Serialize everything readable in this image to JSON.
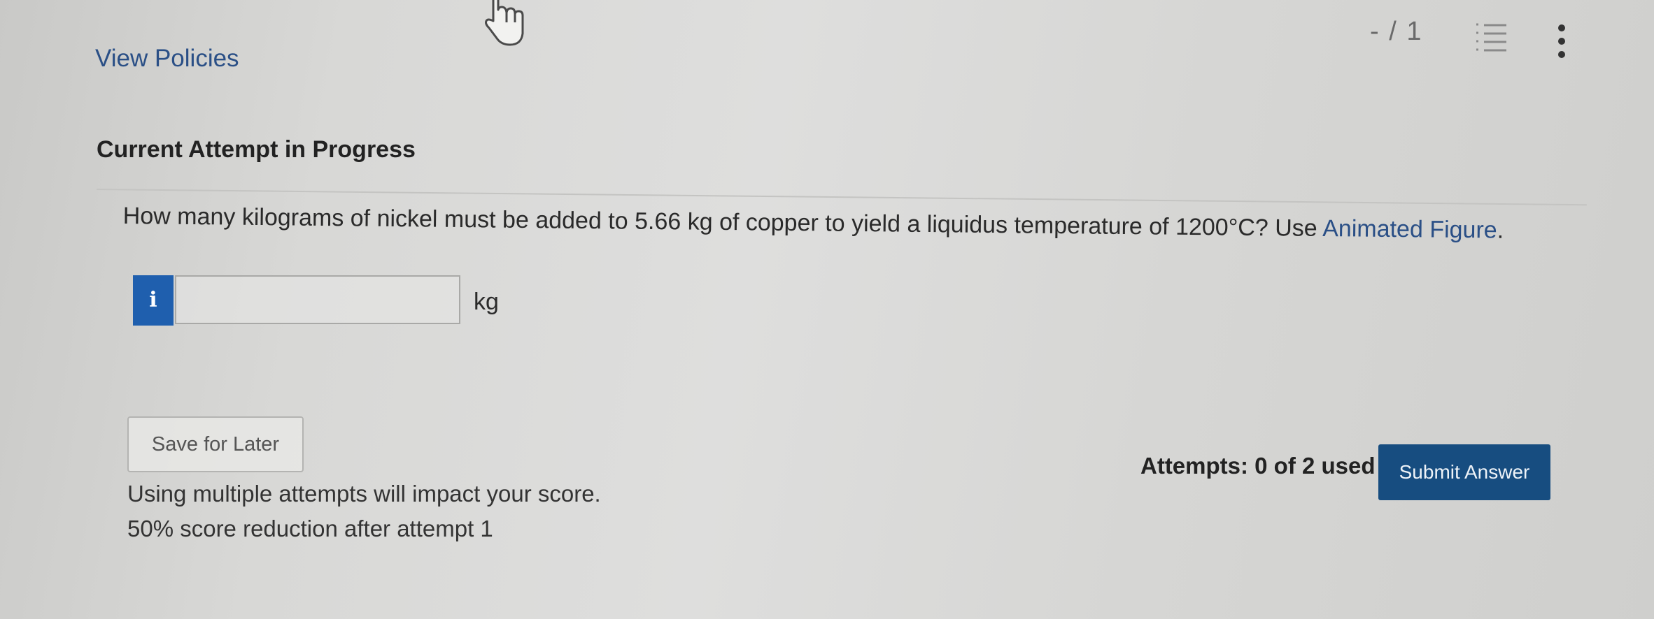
{
  "header": {
    "view_policies": "View Policies",
    "score": "- / 1",
    "icons": {
      "cursor": "hand-pointer-icon",
      "outline": "numbered-list-icon",
      "more": "kebab-menu-icon"
    }
  },
  "attempt": {
    "heading": "Current Attempt in Progress"
  },
  "question": {
    "text": "How many kilograms of nickel must be added to 5.66 kg of copper to yield a liquidus temperature of 1200°C? Use ",
    "link": "Animated Figure",
    "end": "."
  },
  "answer": {
    "info_badge": "i",
    "value": "",
    "unit": "kg"
  },
  "footer": {
    "save_label": "Save for Later",
    "warning_line1": "Using multiple attempts will impact your score.",
    "warning_line2": "50% score reduction after attempt 1",
    "attempts_text": "Attempts: 0 of 2 used",
    "submit_label": "Submit Answer"
  },
  "colors": {
    "link": "#2a4f86",
    "submit_bg": "#174d80",
    "info_badge_bg": "#1f5fae"
  }
}
